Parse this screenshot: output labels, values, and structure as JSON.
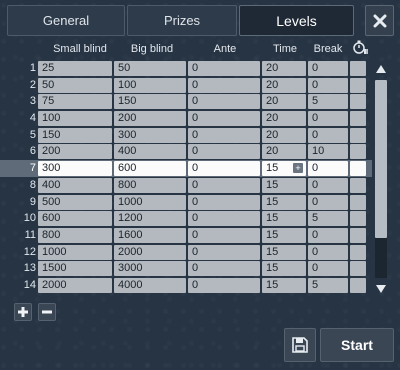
{
  "tabs": [
    {
      "label": "General",
      "active": false
    },
    {
      "label": "Prizes",
      "active": false
    },
    {
      "label": "Levels",
      "active": true
    }
  ],
  "columns": {
    "small_blind": "Small blind",
    "big_blind": "Big blind",
    "ante": "Ante",
    "time": "Time",
    "break": "Break"
  },
  "icons": {
    "close": "close-icon",
    "timer": "stopwatch-icon",
    "add": "plus-icon",
    "remove": "minus-icon",
    "save": "floppy-disk-icon",
    "scroll_up": "arrow-up-icon",
    "scroll_down": "arrow-down-icon",
    "stepper": "plus-small-icon"
  },
  "levels": [
    {
      "num": "1",
      "small": "25",
      "big": "50",
      "ante": "0",
      "time": "20",
      "brk": "0",
      "extra": ""
    },
    {
      "num": "2",
      "small": "50",
      "big": "100",
      "ante": "0",
      "time": "20",
      "brk": "0",
      "extra": ""
    },
    {
      "num": "3",
      "small": "75",
      "big": "150",
      "ante": "0",
      "time": "20",
      "brk": "5",
      "extra": ""
    },
    {
      "num": "4",
      "small": "100",
      "big": "200",
      "ante": "0",
      "time": "20",
      "brk": "0",
      "extra": ""
    },
    {
      "num": "5",
      "small": "150",
      "big": "300",
      "ante": "0",
      "time": "20",
      "brk": "0",
      "extra": ""
    },
    {
      "num": "6",
      "small": "200",
      "big": "400",
      "ante": "0",
      "time": "20",
      "brk": "10",
      "extra": ""
    },
    {
      "num": "7",
      "small": "300",
      "big": "600",
      "ante": "0",
      "time": "15",
      "brk": "0",
      "extra": "",
      "selected": true
    },
    {
      "num": "8",
      "small": "400",
      "big": "800",
      "ante": "0",
      "time": "15",
      "brk": "0",
      "extra": ""
    },
    {
      "num": "9",
      "small": "500",
      "big": "1000",
      "ante": "0",
      "time": "15",
      "brk": "0",
      "extra": ""
    },
    {
      "num": "10",
      "small": "600",
      "big": "1200",
      "ante": "0",
      "time": "15",
      "brk": "5",
      "extra": ""
    },
    {
      "num": "11",
      "small": "800",
      "big": "1600",
      "ante": "0",
      "time": "15",
      "brk": "0",
      "extra": ""
    },
    {
      "num": "12",
      "small": "1000",
      "big": "2000",
      "ante": "0",
      "time": "15",
      "brk": "0",
      "extra": ""
    },
    {
      "num": "13",
      "small": "1500",
      "big": "3000",
      "ante": "0",
      "time": "15",
      "brk": "0",
      "extra": ""
    },
    {
      "num": "14",
      "small": "2000",
      "big": "4000",
      "ante": "0",
      "time": "15",
      "brk": "5",
      "extra": ""
    }
  ],
  "buttons": {
    "start": "Start"
  },
  "colors": {
    "background": "#273444",
    "cell": "#b3b9bf",
    "selected_cell": "#fbfbfb",
    "selected_row": "#5f6b78"
  }
}
